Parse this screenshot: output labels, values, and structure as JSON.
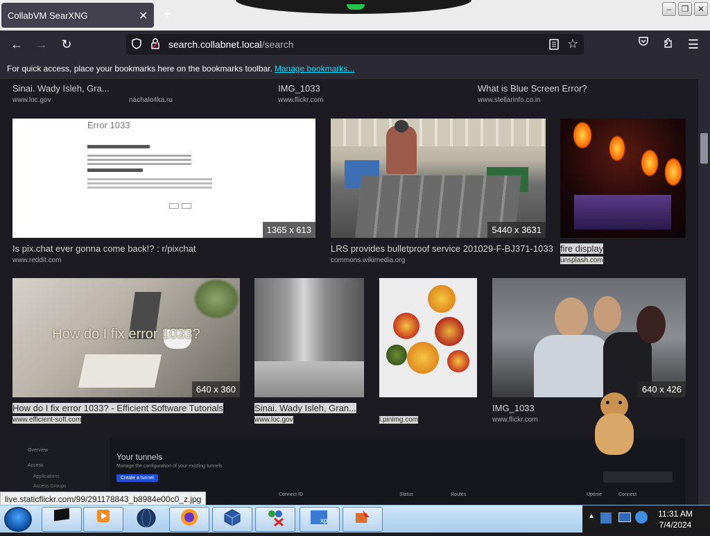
{
  "window": {
    "tab_title": "CollabVM SearXNG",
    "tab_close": "✕",
    "new_tab": "+",
    "minimize": "–",
    "restore": "❐",
    "close": "✕"
  },
  "nav": {
    "back": "←",
    "forward": "→",
    "reload": "↻",
    "url_host": "search.collabnet.local",
    "url_path": "/search",
    "reader_icon": "reader-view-icon",
    "star_icon": "bookmark-star-icon",
    "pocket_icon": "pocket-icon",
    "extensions_icon": "extensions-icon",
    "menu_icon": "hamburger-menu-icon"
  },
  "bookmarks_bar": {
    "message": "For quick access, place your bookmarks here on the bookmarks toolbar.",
    "manage_link": "Manage bookmarks..."
  },
  "results_row0": [
    {
      "title": "Sinai. Wady Isleh, Gra...",
      "source": "www.loc.gov"
    },
    {
      "title": "",
      "source": "nachalo4ka.ru"
    },
    {
      "title": "IMG_1033",
      "source": "www.flickr.com"
    },
    {
      "title": "What is Blue Screen Error?",
      "source": "www.stellarinfo.co.in"
    }
  ],
  "results_row1": [
    {
      "title": "Is pix.chat ever gonna come back!? : r/pixchat",
      "source": "www.reddit.com",
      "dims": "1365 x 613",
      "image_text": "Error 1033"
    },
    {
      "title": "LRS provides bulletproof service 201029-F-BJ371-1033",
      "source": "commons.wikimedia.org",
      "dims": "5440 x 3631"
    },
    {
      "title": "fire display",
      "source": "unsplash.com",
      "dims": ""
    }
  ],
  "results_row2": [
    {
      "title": "How do I fix error 1033? - Efficient Software Tutorials",
      "source": "www.efficient-soft.com",
      "dims": "640 x 360",
      "image_text": "How do I fix error 1033?"
    },
    {
      "title": "Sinai. Wady Isleh, Gran...",
      "source": "www.loc.gov",
      "dims": ""
    },
    {
      "title": "",
      "source": "i.pinimg.com",
      "dims": ""
    },
    {
      "title": "IMG_1033",
      "source": "www.flickr.com",
      "dims": "640 x 426"
    }
  ],
  "row3_snippet": {
    "heading": "Your tunnels",
    "sub": "Manage the configuration of your existing tunnels",
    "button": "Create a tunnel",
    "side1": "Overview",
    "side2": "Access",
    "side3": "Applications",
    "side4": "Access Groups",
    "col1": "Connect ID",
    "col2": "Status",
    "col3": "Routes",
    "col4": "Uptime",
    "col5": "Connect"
  },
  "status_url": "live.staticflickr.com/99/291178843_b8984e00c0_z.jpg",
  "taskbar": {
    "items": [
      "black-window-icon",
      "media-player-icon",
      "globe-icon",
      "firefox-icon",
      "virtualbox-icon",
      "network-people-icon",
      "xp-logo-icon",
      "paint-icon"
    ],
    "time": "11:31 AM",
    "date": "7/4/2024"
  },
  "colors": {
    "page_bg": "#1c1b22",
    "toolbar_bg": "#2b2a33",
    "link_cyan": "#00ddff",
    "taskbar": "#a9cdee"
  }
}
